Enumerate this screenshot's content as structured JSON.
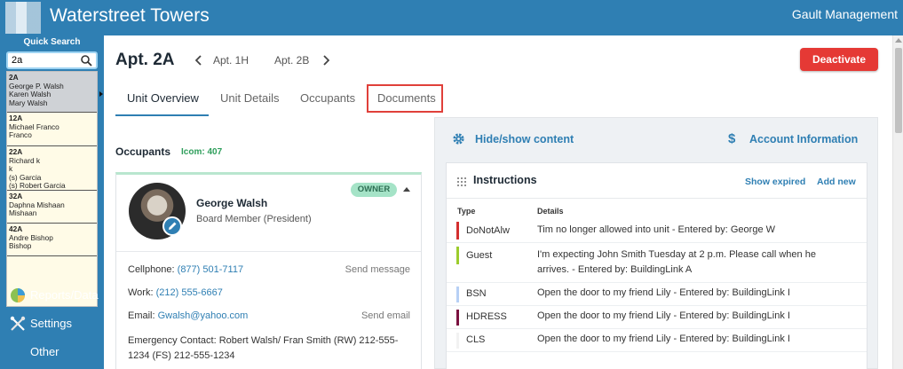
{
  "header": {
    "title": "Waterstreet Towers",
    "management": "Gault Management"
  },
  "sidebar": {
    "quick_search_label": "Quick Search",
    "search_value": "2a",
    "results": [
      {
        "apt": "2A",
        "names": [
          "George P. Walsh",
          "Karen Walsh",
          "Mary Walsh"
        ]
      },
      {
        "apt": "12A",
        "names": [
          "Michael Franco",
          "Franco"
        ]
      },
      {
        "apt": "22A",
        "names": [
          "Richard k",
          "k",
          "(s) Garcia",
          "(s) Robert Garcia"
        ]
      },
      {
        "apt": "32A",
        "names": [
          "Daphna Mishaan",
          "Mishaan"
        ]
      },
      {
        "apt": "42A",
        "names": [
          "Andre Bishop",
          "Bishop"
        ]
      }
    ],
    "nav": [
      {
        "label": "Reports/Data",
        "icon": "pie-chart-icon"
      },
      {
        "label": "Settings",
        "icon": "tools-icon"
      },
      {
        "label": "Other",
        "icon": ""
      }
    ]
  },
  "unit": {
    "title": "Apt. 2A",
    "prev_label": "Apt. 1H",
    "next_label": "Apt. 2B",
    "deactivate_label": "Deactivate"
  },
  "tabs": [
    {
      "label": "Unit Overview",
      "active": true
    },
    {
      "label": "Unit Details",
      "active": false
    },
    {
      "label": "Occupants",
      "active": false
    },
    {
      "label": "Documents",
      "active": false,
      "highlighted": true
    }
  ],
  "occupants": {
    "heading": "Occupants",
    "icom": "Icom: 407",
    "card": {
      "name": "George Walsh",
      "role": "Board Member (President)",
      "badge": "OWNER",
      "cellphone_label": "Cellphone:",
      "cellphone": "(877) 501-7117",
      "send_message": "Send message",
      "work_label": "Work:",
      "work": "(212) 555-6667",
      "email_label": "Email:",
      "email": "Gwalsh@yahoo.com",
      "send_email": "Send email",
      "emergency_label": "Emergency Contact:",
      "emergency_line1": "Robert Walsh/ Fran Smith (RW) 212-555-",
      "emergency_line2": "1234 (FS) 212-555-1234"
    }
  },
  "panel": {
    "hide_show": "Hide/show content",
    "account_info": "Account Information",
    "instructions": {
      "title": "Instructions",
      "show_expired": "Show expired",
      "add_new": "Add new",
      "col_type": "Type",
      "col_details": "Details",
      "rows": [
        {
          "type": "DoNotAlw",
          "color": "#d32f2f",
          "details": "Tim no longer allowed into unit  - Entered by: George W"
        },
        {
          "type": "Guest",
          "color": "#9ccc2c",
          "details": "I'm expecting John Smith Tuesday at 2 p.m. Please call when he arrives.  - Entered by: BuildingLink A"
        },
        {
          "type": "BSN",
          "color": "#b7d0f5",
          "details": "Open the door to my friend Lily  - Entered by: BuildingLink I"
        },
        {
          "type": "HDRESS",
          "color": "#7b1140",
          "details": "Open the door to my friend Lily  - Entered by: BuildingLink I"
        },
        {
          "type": "CLS",
          "color": "#f2f2f2",
          "details": "Open the door to my friend Lily  - Entered by: BuildingLink I"
        }
      ]
    }
  }
}
